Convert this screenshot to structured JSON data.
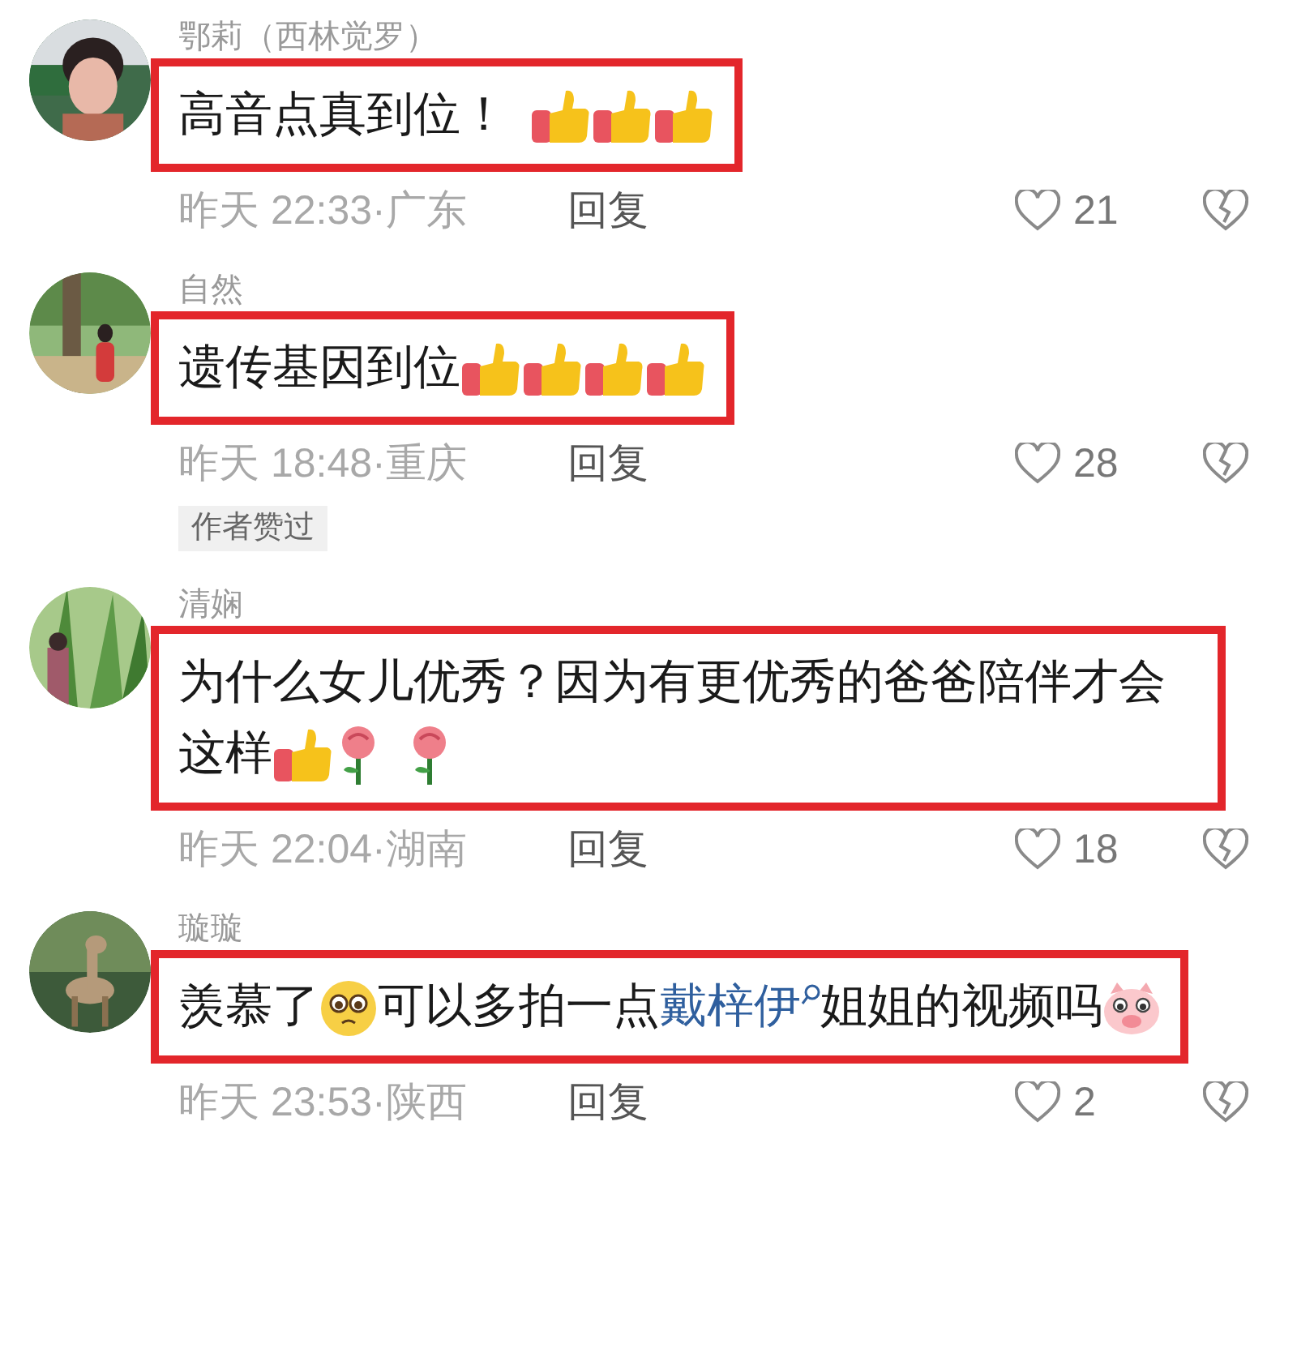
{
  "comments": [
    {
      "avatar": {
        "kind": "picture"
      },
      "name": "鄂莉（西林觉罗）",
      "highlighted": true,
      "body": [
        {
          "kind": "text",
          "text": "高音点真到位！"
        },
        {
          "kind": "gap"
        },
        {
          "kind": "thumbs_up"
        },
        {
          "kind": "thumbs_up"
        },
        {
          "kind": "thumbs_up"
        }
      ],
      "meta": "昨天 22:33·广东",
      "reply": "回复",
      "likes": "21"
    },
    {
      "avatar": {
        "kind": "picture"
      },
      "name": "自然",
      "highlighted": true,
      "body": [
        {
          "kind": "text",
          "text": "遗传基因到位"
        },
        {
          "kind": "thumbs_up"
        },
        {
          "kind": "thumbs_up"
        },
        {
          "kind": "thumbs_up"
        },
        {
          "kind": "thumbs_up"
        }
      ],
      "meta": "昨天 18:48·重庆",
      "reply": "回复",
      "likes": "28",
      "badge": "作者赞过"
    },
    {
      "avatar": {
        "kind": "picture"
      },
      "name": "清娴",
      "highlighted": true,
      "body": [
        {
          "kind": "text",
          "text": "为什么女儿优秀？因为有更优秀的爸爸陪伴才会这样"
        },
        {
          "kind": "thumbs_up"
        },
        {
          "kind": "rose"
        },
        {
          "kind": "gap"
        },
        {
          "kind": "rose"
        }
      ],
      "meta": "昨天 22:04·湖南",
      "reply": "回复",
      "likes": "18"
    },
    {
      "avatar": {
        "kind": "picture"
      },
      "name": "璇璇",
      "highlighted": true,
      "body": [
        {
          "kind": "text",
          "text": "羡慕了"
        },
        {
          "kind": "pleading_face"
        },
        {
          "kind": "text",
          "text": "可以多拍一点"
        },
        {
          "kind": "link",
          "text": "戴梓伊"
        },
        {
          "kind": "text",
          "text": "姐姐的视频吗"
        },
        {
          "kind": "pig_face"
        }
      ],
      "meta": "昨天 23:53·陕西",
      "reply": "回复",
      "likes": "2"
    }
  ]
}
